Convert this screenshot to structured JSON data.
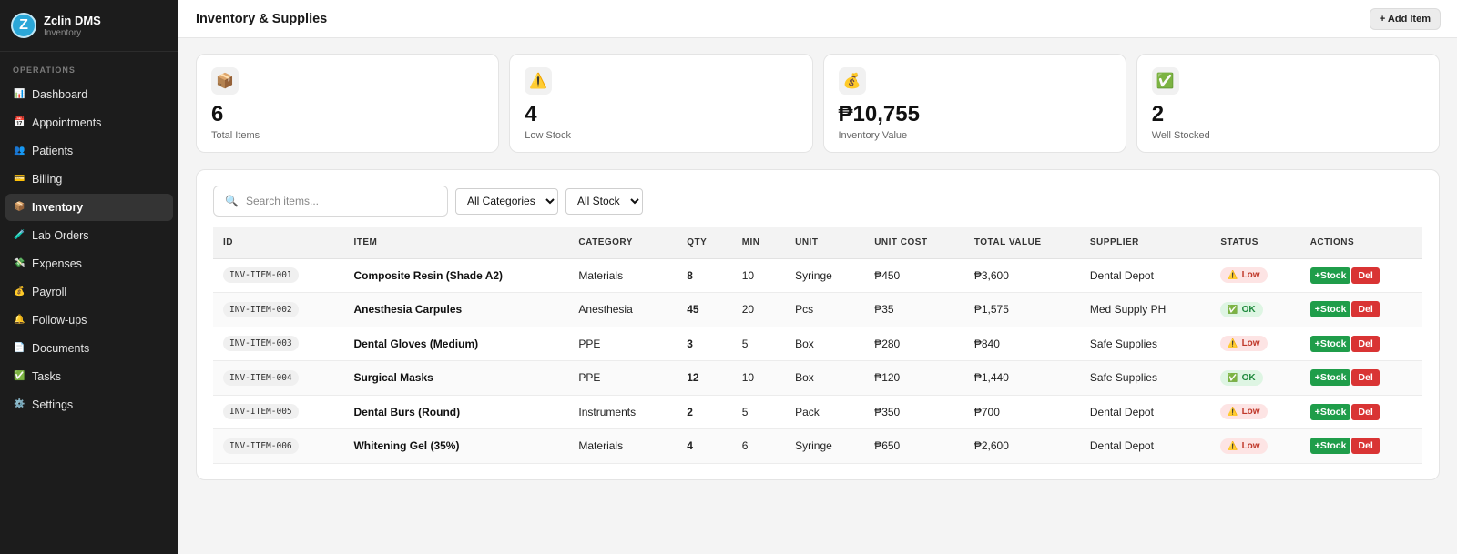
{
  "brand": {
    "logo_letter": "Z",
    "name": "Zclin DMS",
    "subtitle": "Inventory"
  },
  "sidebar": {
    "section_label": "OPERATIONS",
    "items": [
      {
        "label": "Dashboard",
        "icon": "bar-chart-icon",
        "glyph": "📊",
        "active": false
      },
      {
        "label": "Appointments",
        "icon": "calendar-icon",
        "glyph": "📅",
        "active": false
      },
      {
        "label": "Patients",
        "icon": "people-icon",
        "glyph": "👥",
        "active": false
      },
      {
        "label": "Billing",
        "icon": "credit-card-icon",
        "glyph": "💳",
        "active": false
      },
      {
        "label": "Inventory",
        "icon": "package-icon",
        "glyph": "📦",
        "active": true
      },
      {
        "label": "Lab Orders",
        "icon": "test-tube-icon",
        "glyph": "🧪",
        "active": false
      },
      {
        "label": "Expenses",
        "icon": "money-icon",
        "glyph": "💸",
        "active": false
      },
      {
        "label": "Payroll",
        "icon": "money-bag-icon",
        "glyph": "💰",
        "active": false
      },
      {
        "label": "Follow-ups",
        "icon": "bell-icon",
        "glyph": "🔔",
        "active": false
      },
      {
        "label": "Documents",
        "icon": "document-icon",
        "glyph": "📄",
        "active": false
      },
      {
        "label": "Tasks",
        "icon": "checkbox-icon",
        "glyph": "✅",
        "active": false
      },
      {
        "label": "Settings",
        "icon": "gear-icon",
        "glyph": "⚙️",
        "active": false
      }
    ]
  },
  "header": {
    "title": "Inventory & Supplies",
    "add_label": "+ Add Item"
  },
  "stats": [
    {
      "icon": "package-icon",
      "glyph": "📦",
      "value": "6",
      "label": "Total Items"
    },
    {
      "icon": "warning-icon",
      "glyph": "⚠️",
      "value": "4",
      "label": "Low Stock"
    },
    {
      "icon": "money-bag-icon",
      "glyph": "💰",
      "value": "₱10,755",
      "label": "Inventory Value"
    },
    {
      "icon": "checkbox-icon",
      "glyph": "✅",
      "value": "2",
      "label": "Well Stocked"
    }
  ],
  "filters": {
    "search_placeholder": "Search items...",
    "category_selected": "All Categories",
    "stock_selected": "All Stock"
  },
  "table": {
    "columns": [
      "ID",
      "ITEM",
      "CATEGORY",
      "QTY",
      "MIN",
      "UNIT",
      "UNIT COST",
      "TOTAL VALUE",
      "SUPPLIER",
      "STATUS",
      "ACTIONS"
    ],
    "stock_label": "+Stock",
    "delete_label": "Del",
    "rows": [
      {
        "id": "INV-ITEM-001",
        "item": "Composite Resin (Shade A2)",
        "category": "Materials",
        "qty": "8",
        "min": "10",
        "unit": "Syringe",
        "unit_cost": "₱450",
        "total": "₱3,600",
        "supplier": "Dental Depot",
        "status": "Low",
        "status_type": "low"
      },
      {
        "id": "INV-ITEM-002",
        "item": "Anesthesia Carpules",
        "category": "Anesthesia",
        "qty": "45",
        "min": "20",
        "unit": "Pcs",
        "unit_cost": "₱35",
        "total": "₱1,575",
        "supplier": "Med Supply PH",
        "status": "OK",
        "status_type": "ok"
      },
      {
        "id": "INV-ITEM-003",
        "item": "Dental Gloves (Medium)",
        "category": "PPE",
        "qty": "3",
        "min": "5",
        "unit": "Box",
        "unit_cost": "₱280",
        "total": "₱840",
        "supplier": "Safe Supplies",
        "status": "Low",
        "status_type": "low"
      },
      {
        "id": "INV-ITEM-004",
        "item": "Surgical Masks",
        "category": "PPE",
        "qty": "12",
        "min": "10",
        "unit": "Box",
        "unit_cost": "₱120",
        "total": "₱1,440",
        "supplier": "Safe Supplies",
        "status": "OK",
        "status_type": "ok"
      },
      {
        "id": "INV-ITEM-005",
        "item": "Dental Burs (Round)",
        "category": "Instruments",
        "qty": "2",
        "min": "5",
        "unit": "Pack",
        "unit_cost": "₱350",
        "total": "₱700",
        "supplier": "Dental Depot",
        "status": "Low",
        "status_type": "low"
      },
      {
        "id": "INV-ITEM-006",
        "item": "Whitening Gel (35%)",
        "category": "Materials",
        "qty": "4",
        "min": "6",
        "unit": "Syringe",
        "unit_cost": "₱650",
        "total": "₱2,600",
        "supplier": "Dental Depot",
        "status": "Low",
        "status_type": "low"
      }
    ]
  }
}
